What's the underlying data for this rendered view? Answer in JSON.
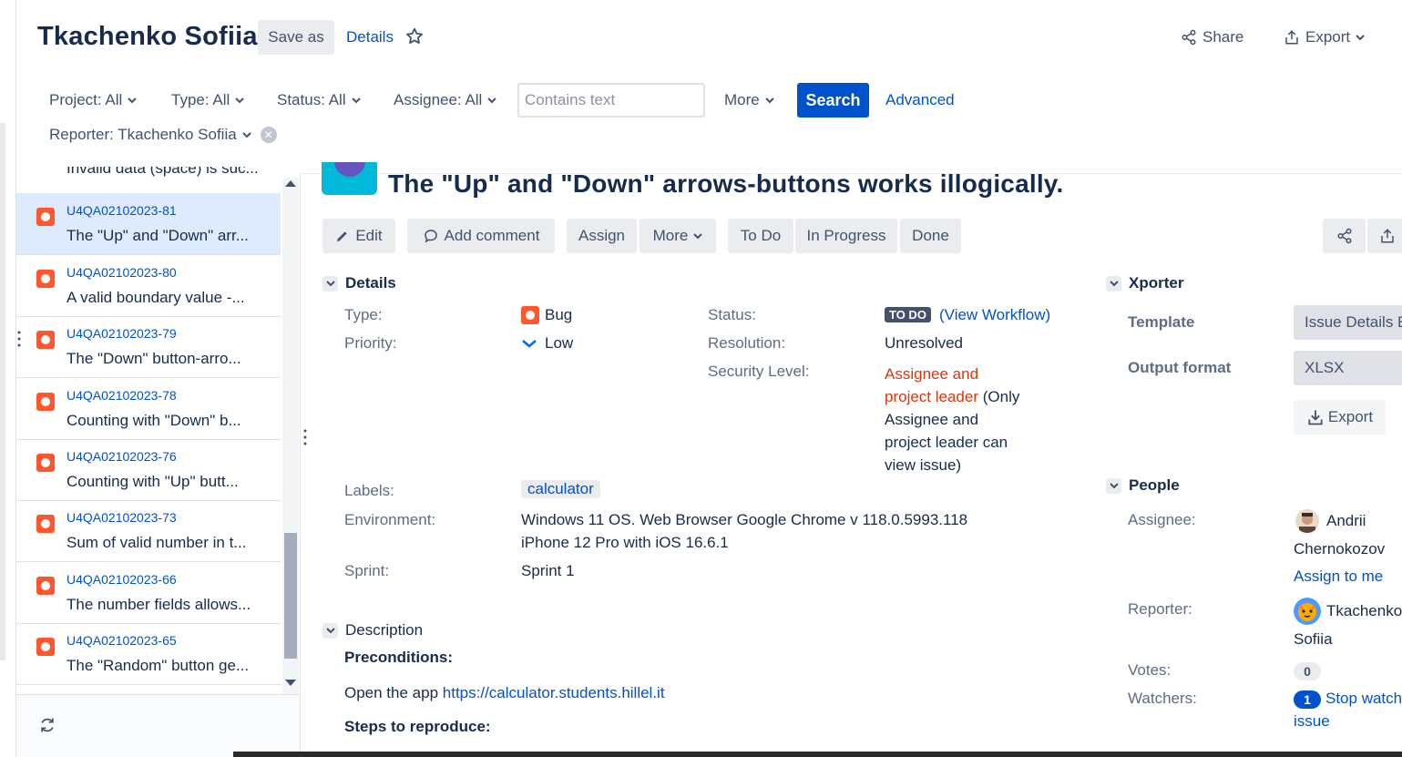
{
  "header": {
    "title": "Tkachenko Sofiia",
    "save_as": "Save as",
    "details": "Details",
    "share": "Share",
    "export": "Export"
  },
  "filters": {
    "project": "Project: All",
    "type": "Type: All",
    "status": "Status: All",
    "assignee": "Assignee: All",
    "contains_placeholder": "Contains text",
    "more": "More",
    "search": "Search",
    "advanced": "Advanced",
    "reporter": "Reporter: Tkachenko Sofiia"
  },
  "list": {
    "cut_item": "Invalid data (space) is suc...",
    "items": [
      {
        "key": "U4QA02102023-81",
        "summary": "The \"Up\" and \"Down\" arr..."
      },
      {
        "key": "U4QA02102023-80",
        "summary": "A valid boundary value -..."
      },
      {
        "key": "U4QA02102023-79",
        "summary": "The \"Down\" button-arro..."
      },
      {
        "key": "U4QA02102023-78",
        "summary": "Counting with \"Down\" b..."
      },
      {
        "key": "U4QA02102023-76",
        "summary": "Counting with \"Up\" butt..."
      },
      {
        "key": "U4QA02102023-73",
        "summary": "Sum of valid number in t..."
      },
      {
        "key": "U4QA02102023-66",
        "summary": "The number fields allows..."
      },
      {
        "key": "U4QA02102023-65",
        "summary": "The \"Random\" button ge..."
      }
    ]
  },
  "issue": {
    "title": "The \"Up\" and \"Down\" arrows-buttons works illogically.",
    "toolbar": {
      "edit": "Edit",
      "add_comment": "Add comment",
      "assign": "Assign",
      "more": "More",
      "todo": "To Do",
      "in_progress": "In Progress",
      "done": "Done"
    },
    "details": {
      "heading": "Details",
      "type_label": "Type:",
      "type_value": "Bug",
      "priority_label": "Priority:",
      "priority_value": "Low",
      "status_label": "Status:",
      "status_badge": "TO DO",
      "view_workflow": "(View Workflow)",
      "resolution_label": "Resolution:",
      "resolution_value": "Unresolved",
      "security_label": "Security Level:",
      "security_red_1": "Assignee and",
      "security_red_2": "project leader",
      "security_note_1": " (Only",
      "security_note_2": "Assignee and",
      "security_note_3": "project leader can",
      "security_note_4": "view issue)",
      "labels_label": "Labels:",
      "labels_value": "calculator",
      "environment_label": "Environment:",
      "environment_line1": "Windows 11 OS. Web Browser Google Chrome v 118.0.5993.118",
      "environment_line2": "iPhone 12 Pro with iOS 16.6.1",
      "sprint_label": "Sprint:",
      "sprint_value": "Sprint 1"
    },
    "description": {
      "heading": "Description",
      "preconditions": "Preconditions:",
      "open_app": "Open the app ",
      "app_link": "https://calculator.students.hillel.it",
      "steps": "Steps to reproduce:"
    }
  },
  "xporter": {
    "heading": "Xporter",
    "template_label": "Template",
    "template_value": "Issue Details E",
    "format_label": "Output format",
    "format_value": "XLSX",
    "export": "Export"
  },
  "people": {
    "heading": "People",
    "assignee_label": "Assignee:",
    "assignee_first": "Andrii",
    "assignee_last": "Chernokozov",
    "assign_to_me": "Assign to me",
    "reporter_label": "Reporter:",
    "reporter_first": "Tkachenko",
    "reporter_last": "Sofiia",
    "votes_label": "Votes:",
    "votes_value": "0",
    "watchers_label": "Watchers:",
    "watchers_value": "1",
    "stop_watching_1": "Stop watch",
    "stop_watching_2": "issue"
  },
  "colors": {
    "primary": "#0052cc",
    "bug": "#ff5630",
    "selected_row": "#deebff",
    "security_red": "#de350b"
  }
}
